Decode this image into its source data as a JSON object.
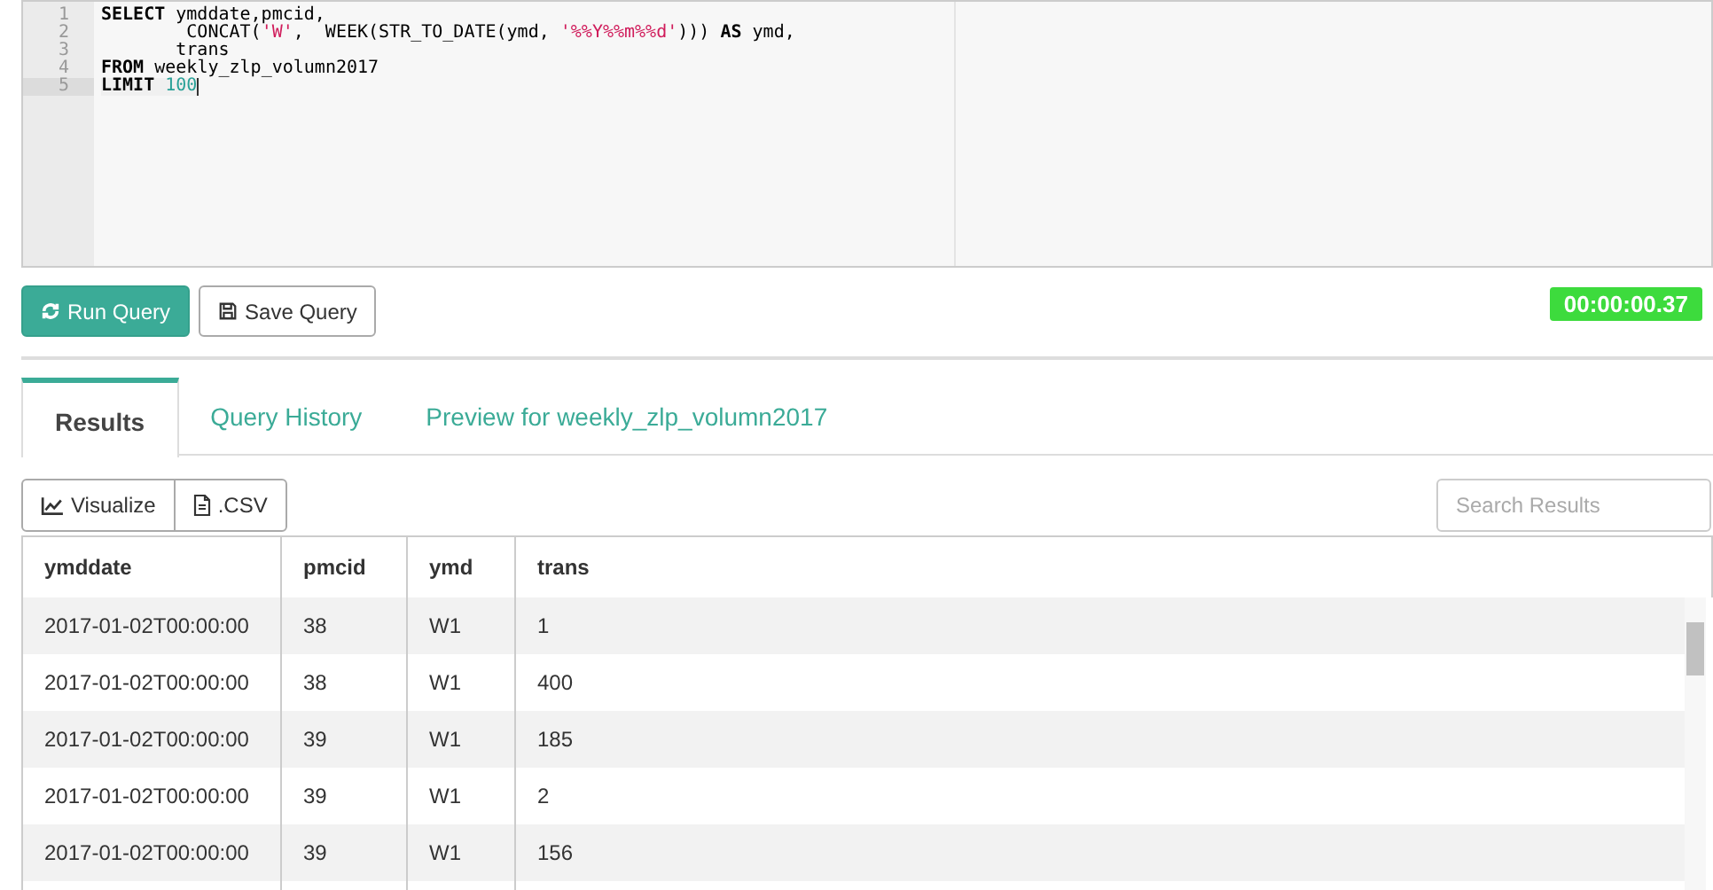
{
  "editor": {
    "lines": [
      {
        "number": "1",
        "active": false,
        "tokens": [
          {
            "kind": "keyword",
            "text": "SELECT"
          },
          {
            "kind": "plain",
            "text": " ymddate,pmcid,"
          }
        ]
      },
      {
        "number": "2",
        "active": false,
        "tokens": [
          {
            "kind": "plain",
            "text": "        CONCAT("
          },
          {
            "kind": "string",
            "text": "'W'"
          },
          {
            "kind": "plain",
            "text": ",  WEEK(STR_TO_DATE(ymd, "
          },
          {
            "kind": "string",
            "text": "'%%Y%%m%%d'"
          },
          {
            "kind": "plain",
            "text": "))) "
          },
          {
            "kind": "keyword",
            "text": "AS"
          },
          {
            "kind": "plain",
            "text": " ymd,"
          }
        ]
      },
      {
        "number": "3",
        "active": false,
        "tokens": [
          {
            "kind": "plain",
            "text": "       trans"
          }
        ]
      },
      {
        "number": "4",
        "active": false,
        "tokens": [
          {
            "kind": "keyword",
            "text": "FROM"
          },
          {
            "kind": "plain",
            "text": " weekly_zlp_volumn2017"
          }
        ]
      },
      {
        "number": "5",
        "active": true,
        "tokens": [
          {
            "kind": "keyword",
            "text": "LIMIT"
          },
          {
            "kind": "number",
            "text": " 100"
          }
        ]
      }
    ]
  },
  "actions": [
    {
      "label": "Run Query",
      "kind": "primary"
    },
    {
      "label": "Save Query",
      "kind": "default"
    }
  ],
  "timer": "00:00:00.37",
  "tabs": [
    {
      "label": "Results",
      "selected": true
    },
    {
      "label": "Query History",
      "selected": false
    },
    {
      "label": "Preview for weekly_zlp_volumn2017",
      "selected": false
    }
  ],
  "toolbar": [
    {
      "label": "Visualize",
      "kind": "chart"
    },
    {
      "label": ".CSV",
      "kind": "file"
    }
  ],
  "search": {
    "placeholder": "Search Results"
  },
  "table": {
    "columns": [
      "ymddate",
      "pmcid",
      "ymd",
      "trans"
    ],
    "rows": [
      [
        "2017-01-02T00:00:00",
        "38",
        "W1",
        "1"
      ],
      [
        "2017-01-02T00:00:00",
        "38",
        "W1",
        "400"
      ],
      [
        "2017-01-02T00:00:00",
        "39",
        "W1",
        "185"
      ],
      [
        "2017-01-02T00:00:00",
        "39",
        "W1",
        "2"
      ],
      [
        "2017-01-02T00:00:00",
        "39",
        "W1",
        "156"
      ]
    ]
  }
}
